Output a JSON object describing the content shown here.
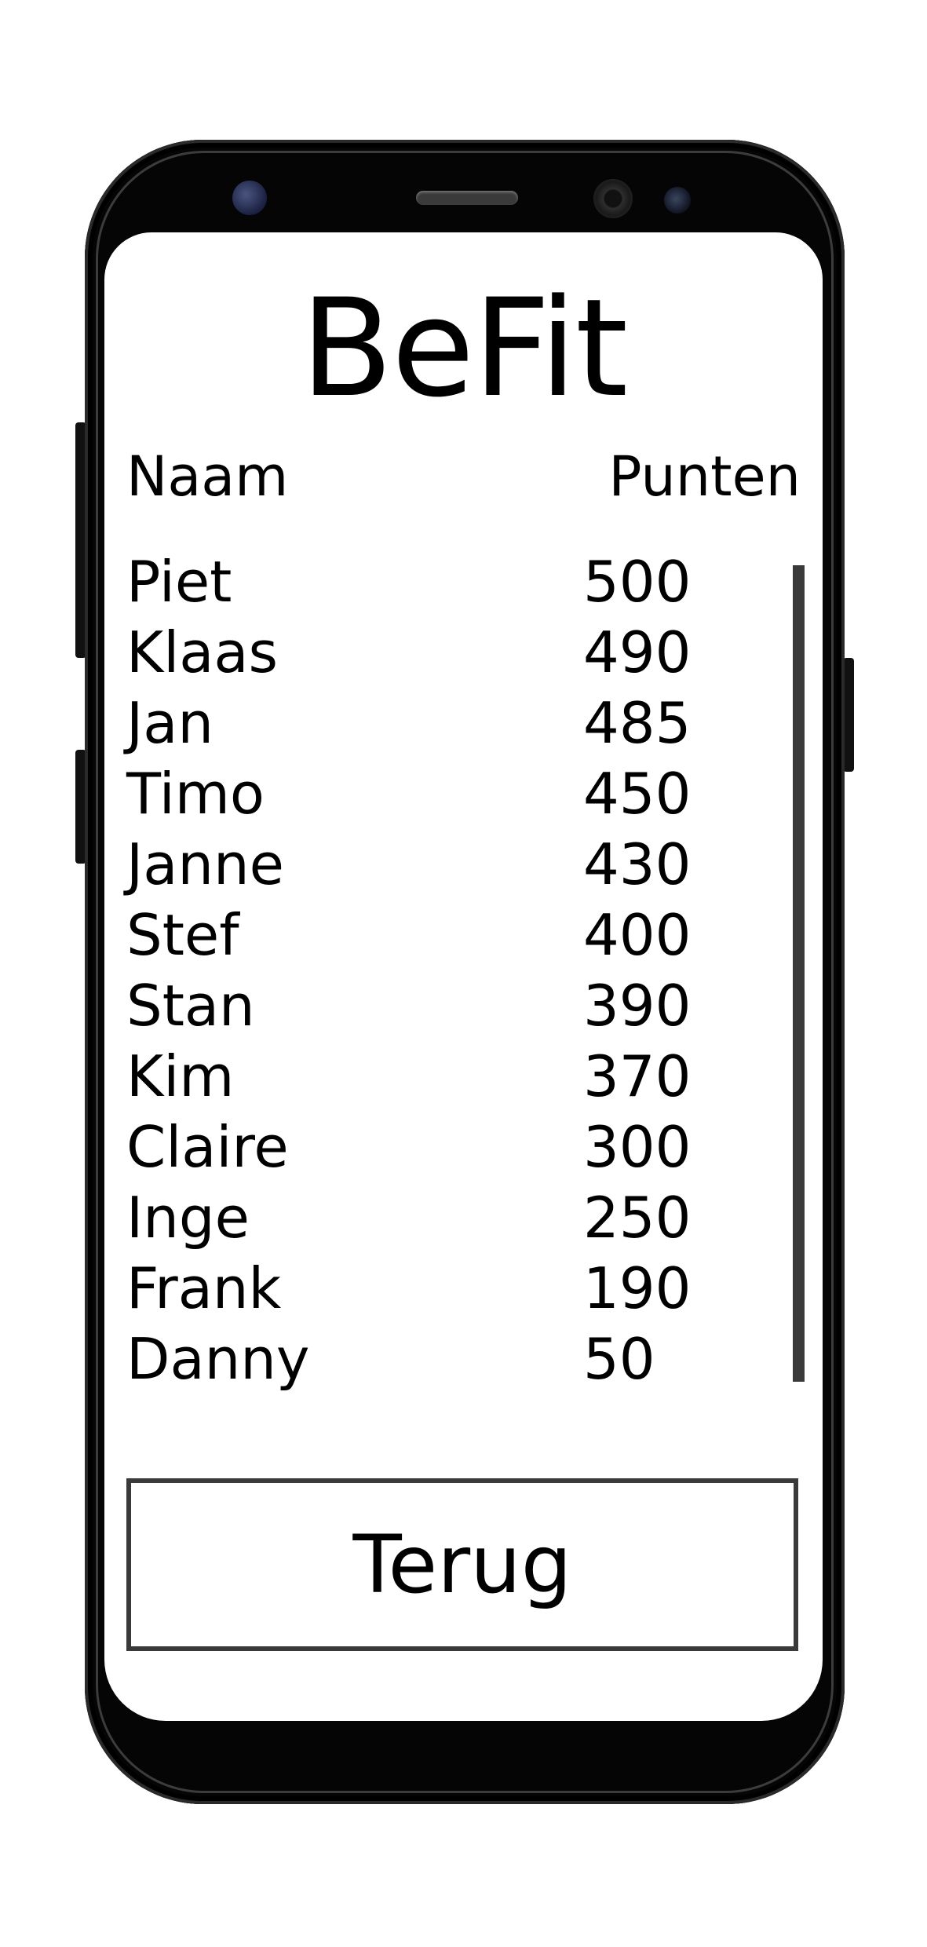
{
  "app": {
    "title": "BeFit"
  },
  "table": {
    "headers": {
      "name": "Naam",
      "score": "Punten"
    },
    "rows": [
      {
        "name": "Piet",
        "score": "500"
      },
      {
        "name": "Klaas",
        "score": "490"
      },
      {
        "name": "Jan",
        "score": "485"
      },
      {
        "name": "Timo",
        "score": "450"
      },
      {
        "name": "Janne",
        "score": "430"
      },
      {
        "name": "Stef",
        "score": "400"
      },
      {
        "name": "Stan",
        "score": "390"
      },
      {
        "name": "Kim",
        "score": "370"
      },
      {
        "name": "Claire",
        "score": "300"
      },
      {
        "name": "Inge",
        "score": "250"
      },
      {
        "name": "Frank",
        "score": "190"
      },
      {
        "name": "Danny",
        "score": "50"
      }
    ]
  },
  "back_button": {
    "label": "Terug"
  },
  "colors": {
    "text": "#000000",
    "border": "#3a3a3a",
    "phone_body": "#050505",
    "screen": "#ffffff"
  }
}
